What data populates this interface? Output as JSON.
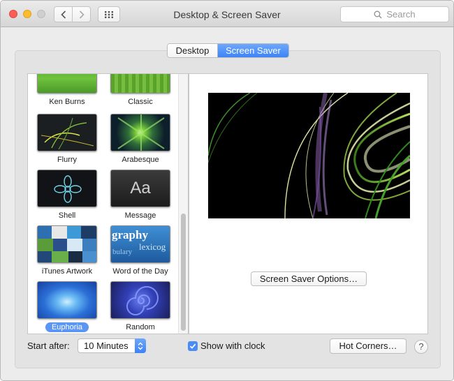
{
  "window": {
    "title": "Desktop & Screen Saver",
    "search_placeholder": "Search"
  },
  "tabs": [
    {
      "label": "Desktop",
      "selected": false
    },
    {
      "label": "Screen Saver",
      "selected": true
    }
  ],
  "savers": [
    {
      "label": "Ken Burns",
      "icon": "ken-burns-thumbnail"
    },
    {
      "label": "Classic",
      "icon": "classic-thumbnail"
    },
    {
      "label": "Flurry",
      "icon": "flurry-thumbnail"
    },
    {
      "label": "Arabesque",
      "icon": "arabesque-thumbnail"
    },
    {
      "label": "Shell",
      "icon": "shell-thumbnail"
    },
    {
      "label": "Message",
      "icon": "message-thumbnail",
      "thumb_text": "Aa"
    },
    {
      "label": "iTunes Artwork",
      "icon": "itunes-artwork-thumbnail"
    },
    {
      "label": "Word of the Day",
      "icon": "word-of-the-day-thumbnail",
      "thumb_text": "graphy",
      "thumb_text2": "lexicog",
      "thumb_text3": "bulary"
    },
    {
      "label": "Euphoria",
      "icon": "euphoria-thumbnail",
      "selected": true
    },
    {
      "label": "Random",
      "icon": "random-thumbnail"
    }
  ],
  "options_button": "Screen Saver Options…",
  "start_after": {
    "label": "Start after:",
    "value": "10 Minutes"
  },
  "show_with_clock": {
    "label": "Show with clock",
    "checked": true
  },
  "hot_corners_button": "Hot Corners…",
  "help_button": "?",
  "colors": {
    "accent": "#3d83f7",
    "selection": "#5b96f4"
  }
}
